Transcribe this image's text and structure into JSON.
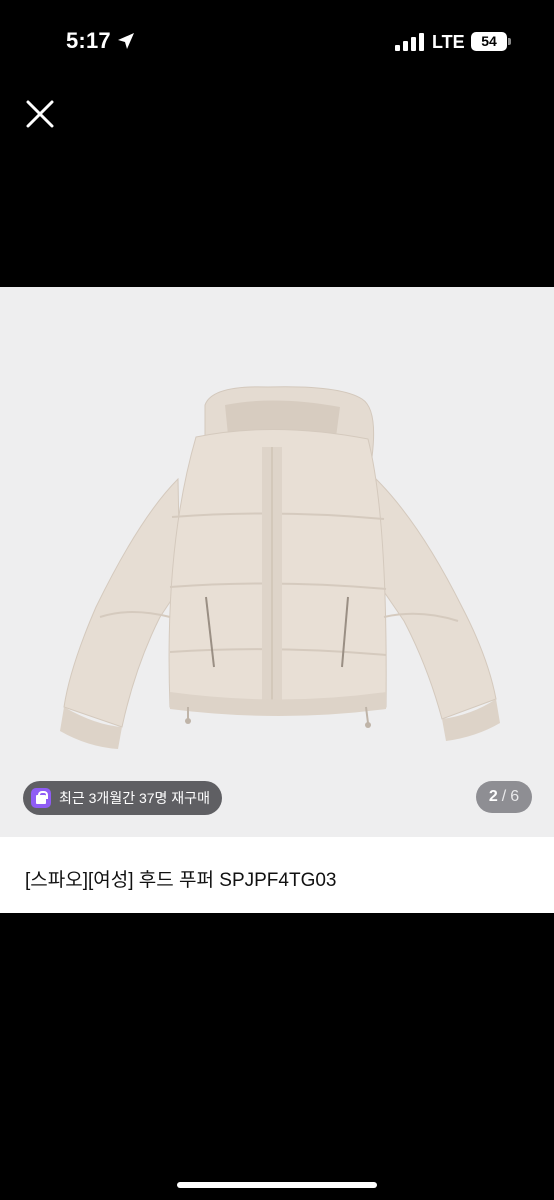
{
  "status_bar": {
    "time": "5:17",
    "network": "LTE",
    "battery": "54"
  },
  "close": {
    "icon": "close-icon"
  },
  "gallery": {
    "rebuy_badge": "최근 3개월간 37명 재구매",
    "current_page": "2",
    "separator": "/",
    "total_pages": "6"
  },
  "product": {
    "title": "[스파오][여성] 후드 푸퍼 SPJPF4TG03"
  },
  "colors": {
    "badge_accent": "#8f5cf5",
    "photo_background": "#eeeeef",
    "jacket": "#e6ddd3"
  }
}
